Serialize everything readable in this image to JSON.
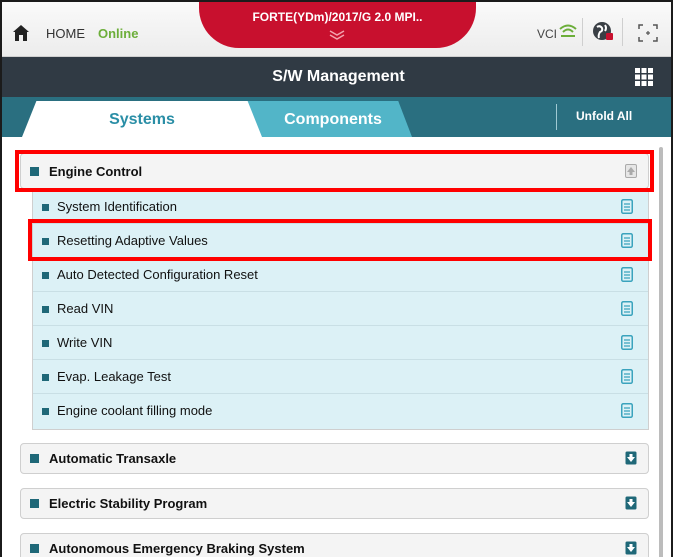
{
  "topbar": {
    "home_label": "HOME",
    "status_label": "Online",
    "vehicle_label": "FORTE(YDm)/2017/G 2.0 MPI..",
    "vci_label": "VCI"
  },
  "titlebar": {
    "title": "S/W Management"
  },
  "tabs": {
    "systems_label": "Systems",
    "components_label": "Components",
    "unfold_label": "Unfold All"
  },
  "groups": [
    {
      "label": "Engine Control",
      "state": "expanded"
    },
    {
      "label": "Automatic Transaxle",
      "state": "collapsed"
    },
    {
      "label": "Electric Stability Program",
      "state": "collapsed"
    },
    {
      "label": "Autonomous Emergency Braking System",
      "state": "collapsed"
    }
  ],
  "engine_items": [
    {
      "label": "System Identification"
    },
    {
      "label": "Resetting Adaptive Values"
    },
    {
      "label": "Auto Detected Configuration Reset"
    },
    {
      "label": "Read VIN"
    },
    {
      "label": "Write VIN"
    },
    {
      "label": "Evap. Leakage Test"
    },
    {
      "label": "Engine coolant filling mode"
    }
  ],
  "colors": {
    "accent_red": "#c8102e",
    "title_bar": "#303a44",
    "tab_bar": "#2a6f80",
    "online_green": "#6cae3a",
    "highlight": "#ff0000",
    "item_bg": "#dcf1f6"
  }
}
